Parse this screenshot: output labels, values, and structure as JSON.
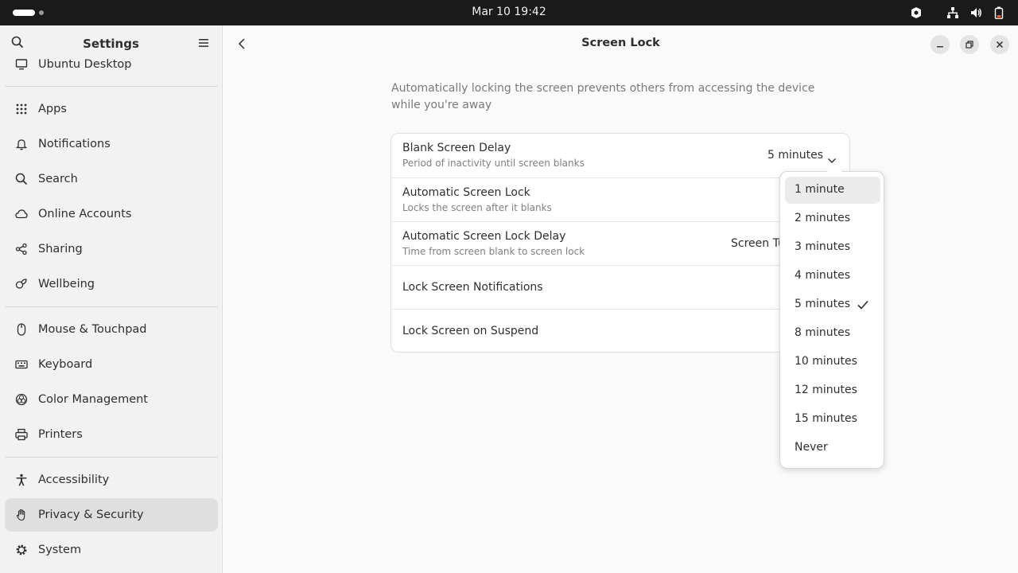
{
  "topbar": {
    "clock": "Mar 10  19:42"
  },
  "sidebar": {
    "title": "Settings",
    "items": [
      {
        "label": "Ubuntu Desktop",
        "icon": "desktop-icon"
      },
      {
        "label": "Apps",
        "icon": "apps-grid-icon"
      },
      {
        "label": "Notifications",
        "icon": "bell-icon"
      },
      {
        "label": "Search",
        "icon": "search-icon"
      },
      {
        "label": "Online Accounts",
        "icon": "cloud-icon"
      },
      {
        "label": "Sharing",
        "icon": "share-icon"
      },
      {
        "label": "Wellbeing",
        "icon": "wellbeing-icon"
      },
      {
        "label": "Mouse & Touchpad",
        "icon": "mouse-icon"
      },
      {
        "label": "Keyboard",
        "icon": "keyboard-icon"
      },
      {
        "label": "Color Management",
        "icon": "color-icon"
      },
      {
        "label": "Printers",
        "icon": "printer-icon"
      },
      {
        "label": "Accessibility",
        "icon": "accessibility-icon"
      },
      {
        "label": "Privacy & Security",
        "icon": "hand-icon"
      },
      {
        "label": "System",
        "icon": "gear-icon"
      }
    ]
  },
  "main": {
    "title": "Screen Lock",
    "intro": "Automatically locking the screen prevents others from accessing the device while you're away",
    "rows": [
      {
        "title": "Blank Screen Delay",
        "subtitle": "Period of inactivity until screen blanks",
        "value": "5 minutes"
      },
      {
        "title": "Automatic Screen Lock",
        "subtitle": "Locks the screen after it blanks"
      },
      {
        "title": "Automatic Screen Lock Delay",
        "subtitle": "Time from screen blank to screen lock",
        "value": "Screen Tu"
      },
      {
        "title": "Lock Screen Notifications"
      },
      {
        "title": "Lock Screen on Suspend"
      }
    ]
  },
  "popover": {
    "options": [
      "1 minute",
      "2 minutes",
      "3 minutes",
      "4 minutes",
      "5 minutes",
      "8 minutes",
      "10 minutes",
      "12 minutes",
      "15 minutes",
      "Never"
    ],
    "selected": "5 minutes",
    "hovered": "1 minute"
  },
  "colors": {
    "topbar": "#1a1a1a",
    "sidebar": "#f2f2f2",
    "selected": "#dfdfdf",
    "background": "#fafafa"
  }
}
